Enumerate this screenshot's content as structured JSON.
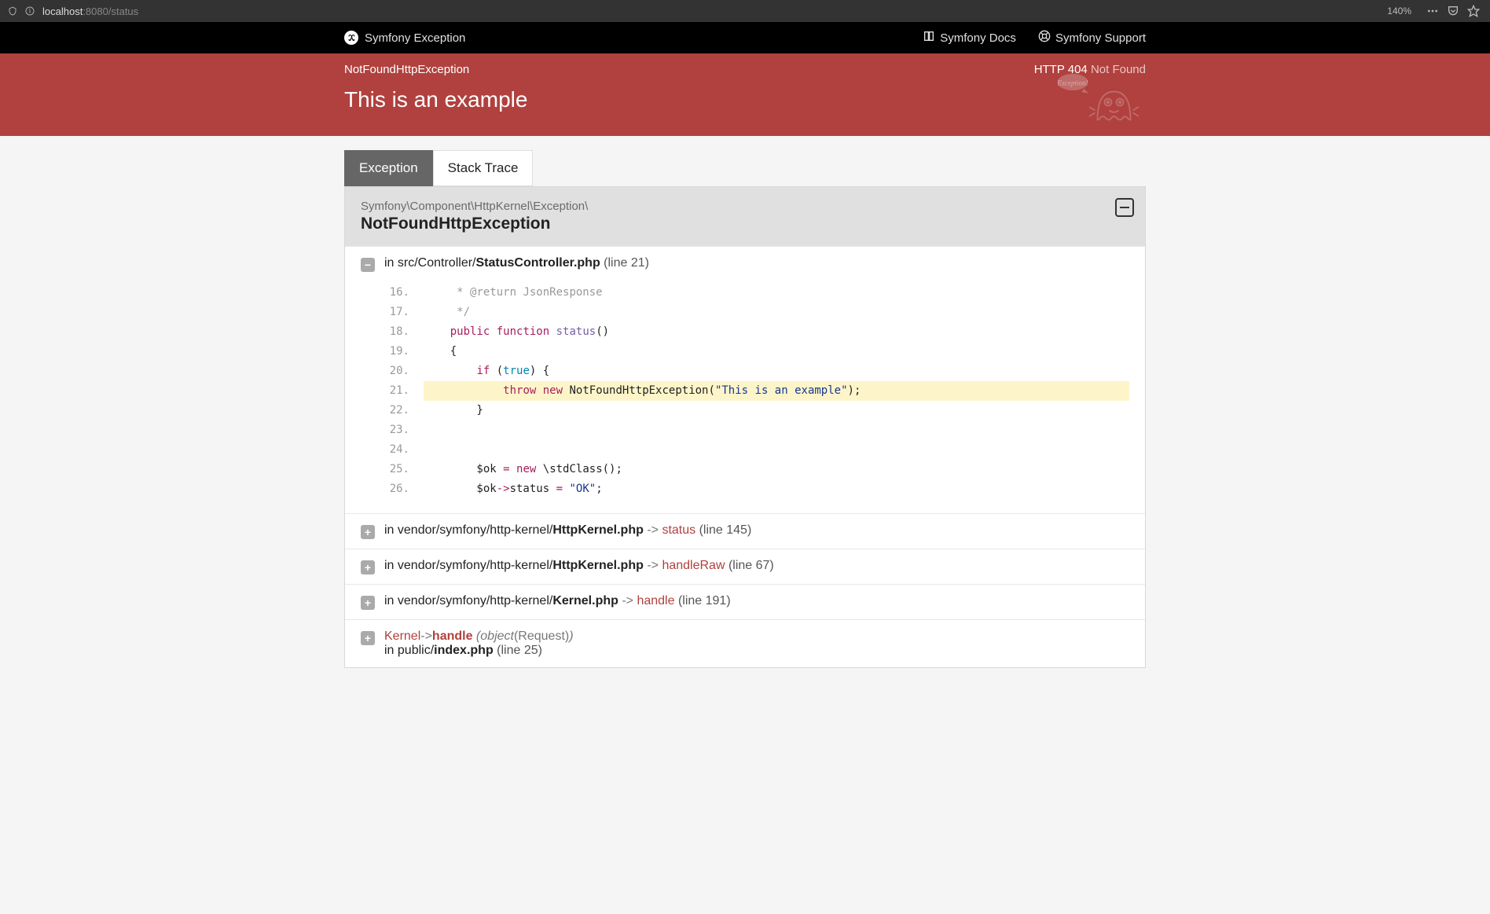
{
  "browser": {
    "url_host": "localhost",
    "url_port": ":8080",
    "url_path": "/status",
    "zoom": "140%"
  },
  "header": {
    "title": "Symfony Exception",
    "docs_label": "Symfony Docs",
    "support_label": "Symfony Support"
  },
  "summary": {
    "exception_class": "NotFoundHttpException",
    "http_code": "HTTP 404",
    "http_status": "Not Found",
    "message": "This is an example"
  },
  "tabs": {
    "exception": "Exception",
    "stack_trace": "Stack Trace"
  },
  "panel": {
    "namespace": "Symfony\\Component\\HttpKernel\\Exception\\",
    "class_name": "NotFoundHttpException"
  },
  "trace": [
    {
      "toggle": "minus",
      "in": "in ",
      "path_prefix": "src/Controller/",
      "path_strong": "StatusController.php",
      "line_info": " (line 21)"
    },
    {
      "toggle": "plus",
      "in": "in ",
      "path_prefix": "vendor/symfony/http-kernel/",
      "path_strong": "HttpKernel.php",
      "arrow": " -> ",
      "method": "status",
      "line_info": " (line 145)"
    },
    {
      "toggle": "plus",
      "in": "in ",
      "path_prefix": "vendor/symfony/http-kernel/",
      "path_strong": "HttpKernel.php",
      "arrow": " -> ",
      "method": "handleRaw",
      "line_info": " (line 67)"
    },
    {
      "toggle": "plus",
      "in": "in ",
      "path_prefix": "vendor/symfony/http-kernel/",
      "path_strong": "Kernel.php",
      "arrow": " -> ",
      "method": "handle",
      "line_info": " (line 191)"
    },
    {
      "toggle": "plus",
      "class_ref": "Kernel",
      "arrow": "->",
      "method": "handle",
      "args_open": " (",
      "args_obj": "object",
      "args_cls": "(Request)",
      "args_close": ")",
      "sub_in": "in ",
      "sub_path_prefix": "public/",
      "sub_path_strong": "index.php",
      "sub_line_info": " (line 25)"
    }
  ],
  "code_lines": [
    {
      "n": "16.",
      "html": "     <span class=\"k-comment\">* @return JsonResponse</span>"
    },
    {
      "n": "17.",
      "html": "     <span class=\"k-comment\">*/</span>"
    },
    {
      "n": "18.",
      "html": "    <span class=\"k-keyword\">public</span> <span class=\"k-keyword\">function</span> <span class=\"k-func\">status</span>()"
    },
    {
      "n": "19.",
      "html": "    {"
    },
    {
      "n": "20.",
      "html": "        <span class=\"k-keyword\">if</span> (<span class=\"k-const\">true</span>) {"
    },
    {
      "n": "21.",
      "html": "            <span class=\"k-keyword\">throw</span> <span class=\"k-keyword\">new</span> <span class=\"k-class\">NotFoundHttpException</span>(<span class=\"k-string\">\"This is an example\"</span>);",
      "hl": true
    },
    {
      "n": "22.",
      "html": "        }"
    },
    {
      "n": "23.",
      "html": ""
    },
    {
      "n": "24.",
      "html": ""
    },
    {
      "n": "25.",
      "html": "        $ok <span class=\"k-keyword\">=</span> <span class=\"k-keyword\">new</span> \\<span class=\"k-class\">stdClass</span>();"
    },
    {
      "n": "26.",
      "html": "        $ok<span class=\"k-keyword\">-&gt;</span>status <span class=\"k-keyword\">=</span> <span class=\"k-string\">\"OK\"</span>;"
    }
  ]
}
